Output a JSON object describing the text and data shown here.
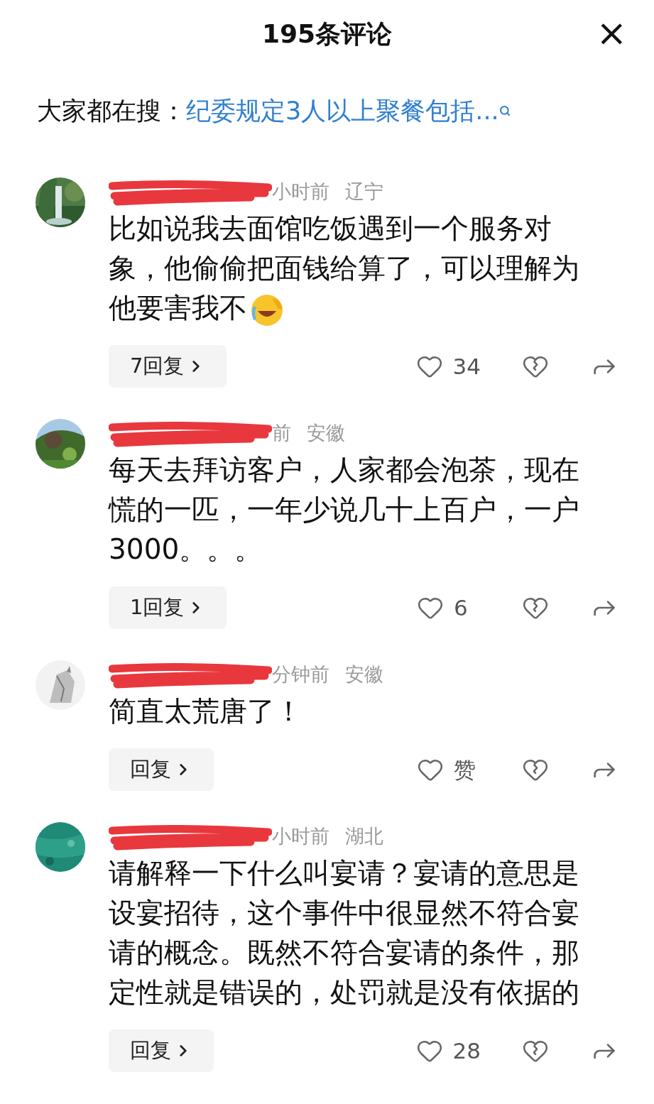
{
  "header": {
    "title": "195条评论",
    "close": "×"
  },
  "search_hint": {
    "label": "大家都在搜：",
    "query": "纪委规定3人以上聚餐包括..."
  },
  "comments": [
    {
      "time": "小时前",
      "location": "辽宁",
      "text": "比如说我去面馆吃饭遇到一个服务对象，他偷偷把面钱给算了，可以理解为他要害我不",
      "emoji": true,
      "reply_button": "7回复",
      "likes": "34"
    },
    {
      "time": "前",
      "location": "安徽",
      "text": "每天去拜访客户，人家都会泡茶，现在慌的一匹，一年少说几十上百户，一户3000。。。",
      "emoji": false,
      "reply_button": "1回复",
      "likes": "6"
    },
    {
      "time": "分钟前",
      "location": "安徽",
      "text": "简直太荒唐了！",
      "emoji": false,
      "reply_button": "回复",
      "likes": "赞"
    },
    {
      "time": "小时前",
      "location": "湖北",
      "text": "请解释一下什么叫宴请？宴请的意思是设宴招待，这个事件中很显然不符合宴请的概念。既然不符合宴请的条件，那定性就是错误的，处罚就是没有依据的",
      "emoji": false,
      "reply_button": "回复",
      "likes": "28"
    }
  ]
}
